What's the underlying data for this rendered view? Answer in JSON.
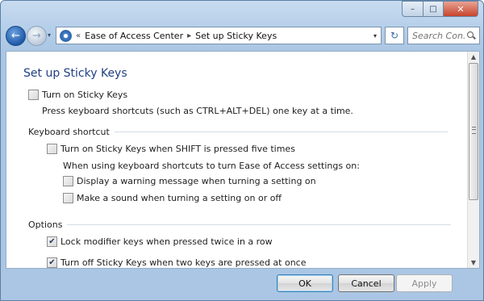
{
  "window": {
    "controls": {
      "minimize": "–",
      "maximize": "□",
      "close": "✕"
    }
  },
  "nav": {
    "back_glyph": "←",
    "forward_glyph": "→",
    "dropdown_glyph": "▾",
    "breadcrumb": {
      "lead_sep": "«",
      "items": [
        "Ease of Access Center",
        "Set up Sticky Keys"
      ],
      "sep": "▸"
    },
    "refresh_glyph": "↻",
    "search_placeholder": "Search Con..."
  },
  "page": {
    "title": "Set up Sticky Keys",
    "main_option": {
      "label": "Turn on Sticky Keys",
      "checked": false
    },
    "main_description": "Press keyboard shortcuts (such as CTRL+ALT+DEL) one key at a time.",
    "keyboard_shortcut": {
      "heading": "Keyboard shortcut",
      "shift_option": {
        "label": "Turn on Sticky Keys when SHIFT is pressed five times",
        "checked": false
      },
      "sub_heading": "When using keyboard shortcuts to turn Ease of Access settings on:",
      "warning_option": {
        "label": "Display a warning message when turning a setting on",
        "checked": false
      },
      "sound_option": {
        "label": "Make a sound when turning a setting on or off",
        "checked": false
      }
    },
    "options": {
      "heading": "Options",
      "lock_option": {
        "label": "Lock modifier keys when pressed twice in a row",
        "checked": true
      },
      "turnoff_option": {
        "label": "Turn off Sticky Keys when two keys are pressed at once",
        "checked": true
      }
    }
  },
  "footer": {
    "ok": "OK",
    "cancel": "Cancel",
    "apply": "Apply"
  },
  "checkmark": "✔"
}
